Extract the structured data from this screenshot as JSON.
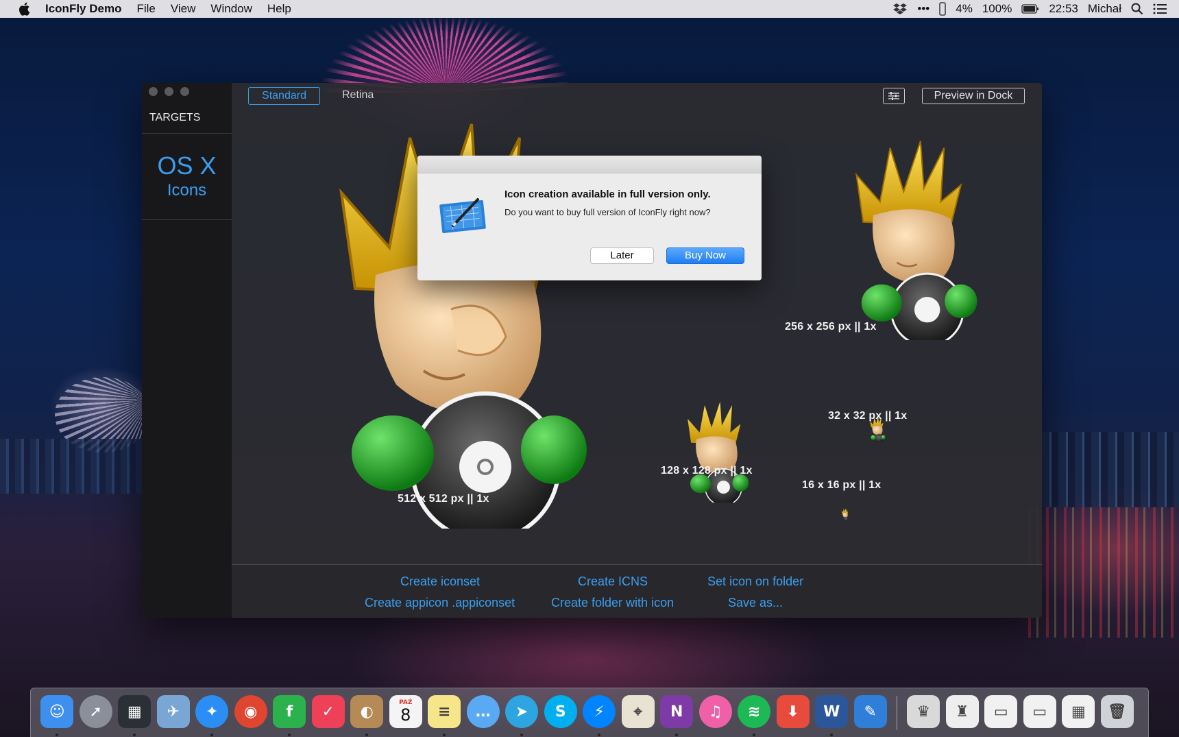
{
  "menubar": {
    "app_name": "IconFly Demo",
    "menus": [
      "File",
      "View",
      "Window",
      "Help"
    ],
    "status": {
      "more": "•••",
      "volume": "4%",
      "battery": "100%",
      "clock": "22:53",
      "user": "Michał"
    }
  },
  "window": {
    "sidebar": {
      "section_title": "TARGETS",
      "target_line1": "OS X",
      "target_line2": "Icons"
    },
    "toolbar": {
      "tab_standard": "Standard",
      "tab_retina": "Retina",
      "preview_dock": "Preview in Dock"
    },
    "previews": [
      {
        "label": "512 x 512 px   ||   1x"
      },
      {
        "label": "256 x 256 px   ||   1x"
      },
      {
        "label": "128 x 128 px   ||   1x"
      },
      {
        "label": "32 x 32 px   ||   1x"
      },
      {
        "label": "16 x 16 px   ||   1x"
      }
    ],
    "actions": {
      "create_iconset": "Create iconset",
      "create_icns": "Create ICNS",
      "set_icon_folder": "Set icon on folder",
      "create_appicon": "Create appicon .appiconset",
      "create_folder_icon": "Create folder with icon",
      "save_as": "Save as..."
    }
  },
  "dialog": {
    "title": "Icon creation available in full version only.",
    "message": "Do you want to buy full version of IconFly right now?",
    "later": "Later",
    "buy_now": "Buy Now"
  },
  "dock": {
    "calendar_month": "PAŹ",
    "calendar_day": "8",
    "apps": [
      {
        "name": "finder-icon",
        "color": "#3d8ff0",
        "glyph": "☺"
      },
      {
        "name": "launchpad-icon",
        "color": "#8a8f9a",
        "glyph": "➚"
      },
      {
        "name": "mission-control-icon",
        "color": "#2b2f36",
        "glyph": "▦"
      },
      {
        "name": "preview-icon",
        "color": "#7aa6d6",
        "glyph": "✈"
      },
      {
        "name": "safari-icon",
        "color": "#2a8ef5",
        "glyph": "✦"
      },
      {
        "name": "chrome-icon",
        "color": "#e0452f",
        "glyph": "◉"
      },
      {
        "name": "feedly-icon",
        "color": "#2bb24c",
        "glyph": "f"
      },
      {
        "name": "pocket-icon",
        "color": "#ee4056",
        "glyph": "✓"
      },
      {
        "name": "contacts-icon",
        "color": "#b58a55",
        "glyph": "◐"
      },
      {
        "name": "calendar-icon",
        "color": "#f4f4f4",
        "glyph": ""
      },
      {
        "name": "notes-icon",
        "color": "#f7e58a",
        "glyph": "≡"
      },
      {
        "name": "messages-icon",
        "color": "#5aa9f5",
        "glyph": "…"
      },
      {
        "name": "telegram-icon",
        "color": "#2ca5e0",
        "glyph": "➤"
      },
      {
        "name": "skype-icon",
        "color": "#00aff0",
        "glyph": "S"
      },
      {
        "name": "messenger-icon",
        "color": "#0084ff",
        "glyph": "⚡"
      },
      {
        "name": "maps-icon",
        "color": "#e8e2d2",
        "glyph": "⌖"
      },
      {
        "name": "onenote-icon",
        "color": "#7e3aa7",
        "glyph": "N"
      },
      {
        "name": "itunes-icon",
        "color": "#f060a8",
        "glyph": "♫"
      },
      {
        "name": "spotify-icon",
        "color": "#1db954",
        "glyph": "≋"
      },
      {
        "name": "downie-icon",
        "color": "#e84b3c",
        "glyph": "⬇"
      },
      {
        "name": "word-icon",
        "color": "#2b579a",
        "glyph": "W"
      },
      {
        "name": "iconfly-icon",
        "color": "#2f7ed8",
        "glyph": "✎"
      }
    ],
    "docs": [
      {
        "name": "stack-iconfly-icon",
        "color": "#d9d9d9",
        "glyph": "♛"
      },
      {
        "name": "stack-people-icon",
        "color": "#eeeeee",
        "glyph": "♜"
      },
      {
        "name": "window-thumb-1-icon",
        "color": "#f1f1f1",
        "glyph": "▭"
      },
      {
        "name": "window-thumb-2-icon",
        "color": "#f1f1f1",
        "glyph": "▭"
      },
      {
        "name": "window-thumb-3-icon",
        "color": "#f1f1f1",
        "glyph": "▦"
      },
      {
        "name": "trash-icon",
        "color": "#cfd3d8",
        "glyph": "🗑"
      }
    ]
  }
}
